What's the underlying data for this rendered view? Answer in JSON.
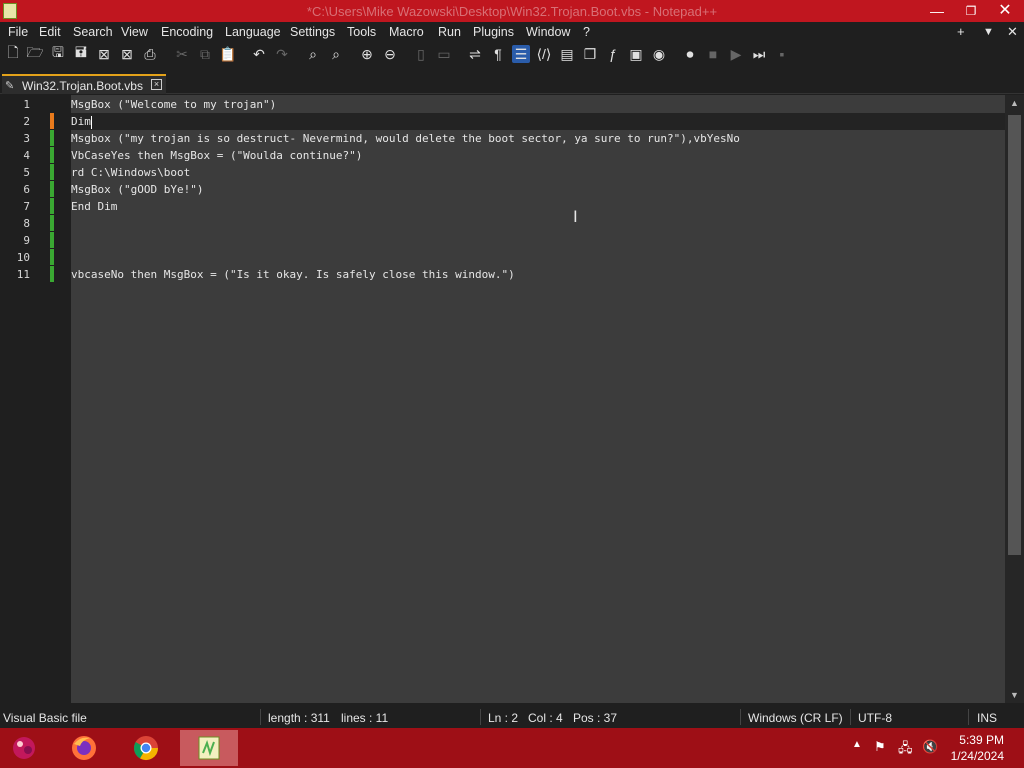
{
  "window": {
    "title": "*C:\\Users\\Mike Wazowski\\Desktop\\Win32.Trojan.Boot.vbs - Notepad++",
    "minimize_icon": "minimize-icon",
    "close_icon": "close-icon"
  },
  "menu": {
    "items": [
      "File",
      "Edit",
      "Search",
      "View",
      "Encoding",
      "Language",
      "Settings",
      "Tools",
      "Macro",
      "Run",
      "Plugins",
      "Window",
      "?"
    ],
    "right": [
      "+",
      "▼",
      "✕"
    ]
  },
  "tab": {
    "label": "Win32.Trojan.Boot.vbs",
    "modified_color": "#e3a21a"
  },
  "editor": {
    "lines": [
      {
        "n": "1",
        "text": "MsgBox (\"Welcome to my trojan\")",
        "current": false,
        "changed": "none"
      },
      {
        "n": "2",
        "text": "Dim",
        "current": true,
        "changed": "unsaved"
      },
      {
        "n": "3",
        "text": "Msgbox (\"my trojan is so destruct- Nevermind, would delete the boot sector, ya sure to run?\"),vbYesNo",
        "current": false,
        "changed": "saved"
      },
      {
        "n": "4",
        "text": "VbCaseYes then MsgBox = (\"Woulda continue?\")",
        "current": false,
        "changed": "saved"
      },
      {
        "n": "5",
        "text": "rd C:\\Windows\\boot",
        "current": false,
        "changed": "saved"
      },
      {
        "n": "6",
        "text": "MsgBox (\"gOOD bYe!\")",
        "current": false,
        "changed": "saved"
      },
      {
        "n": "7",
        "text": "End Dim",
        "current": false,
        "changed": "saved"
      },
      {
        "n": "8",
        "text": "",
        "current": false,
        "changed": "saved"
      },
      {
        "n": "9",
        "text": "",
        "current": false,
        "changed": "saved"
      },
      {
        "n": "10",
        "text": "",
        "current": false,
        "changed": "saved"
      },
      {
        "n": "11",
        "text": "vbcaseNo then MsgBox = (\"Is it okay. Is safely close this window.\")",
        "current": false,
        "changed": "saved"
      }
    ],
    "colors": {
      "saved_change": "#3aa832",
      "unsaved_change": "#e87a1c"
    }
  },
  "status": {
    "language": "Visual Basic file",
    "length": "length : 311",
    "lines": "lines : 11",
    "ln": "Ln : 2",
    "col": "Col : 4",
    "pos": "Pos : 37",
    "eol": "Windows (CR LF)",
    "encoding": "UTF-8",
    "mode": "INS"
  },
  "taskbar": {
    "time": "5:39 PM",
    "date": "1/24/2024",
    "apps": [
      "start-icon",
      "firefox-icon",
      "chrome-icon",
      "notepadpp-icon"
    ]
  }
}
